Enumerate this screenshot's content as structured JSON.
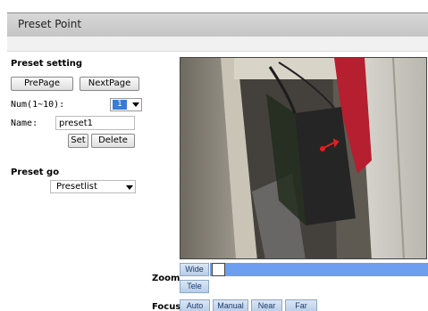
{
  "header": {
    "title": "Preset Point"
  },
  "preset_setting": {
    "heading": "Preset setting",
    "prev_page_label": "PrePage",
    "next_page_label": "NextPage",
    "num_label": "Num(1~10):",
    "num_value": "1",
    "name_label": "Name:",
    "name_value": "preset1",
    "set_label": "Set",
    "delete_label": "Delete"
  },
  "preset_go": {
    "heading": "Preset go",
    "list_value": "Presetlist"
  },
  "controls": {
    "zoom_label": "Zoom",
    "wide_label": "Wide",
    "tele_label": "Tele",
    "focus_label": "Focus",
    "focus_buttons": [
      "Auto",
      "Manual",
      "Near",
      "Far"
    ]
  },
  "colors": {
    "accent": "#6d9ef0",
    "selected": "#3a7bd5",
    "marker": "#e02020"
  }
}
